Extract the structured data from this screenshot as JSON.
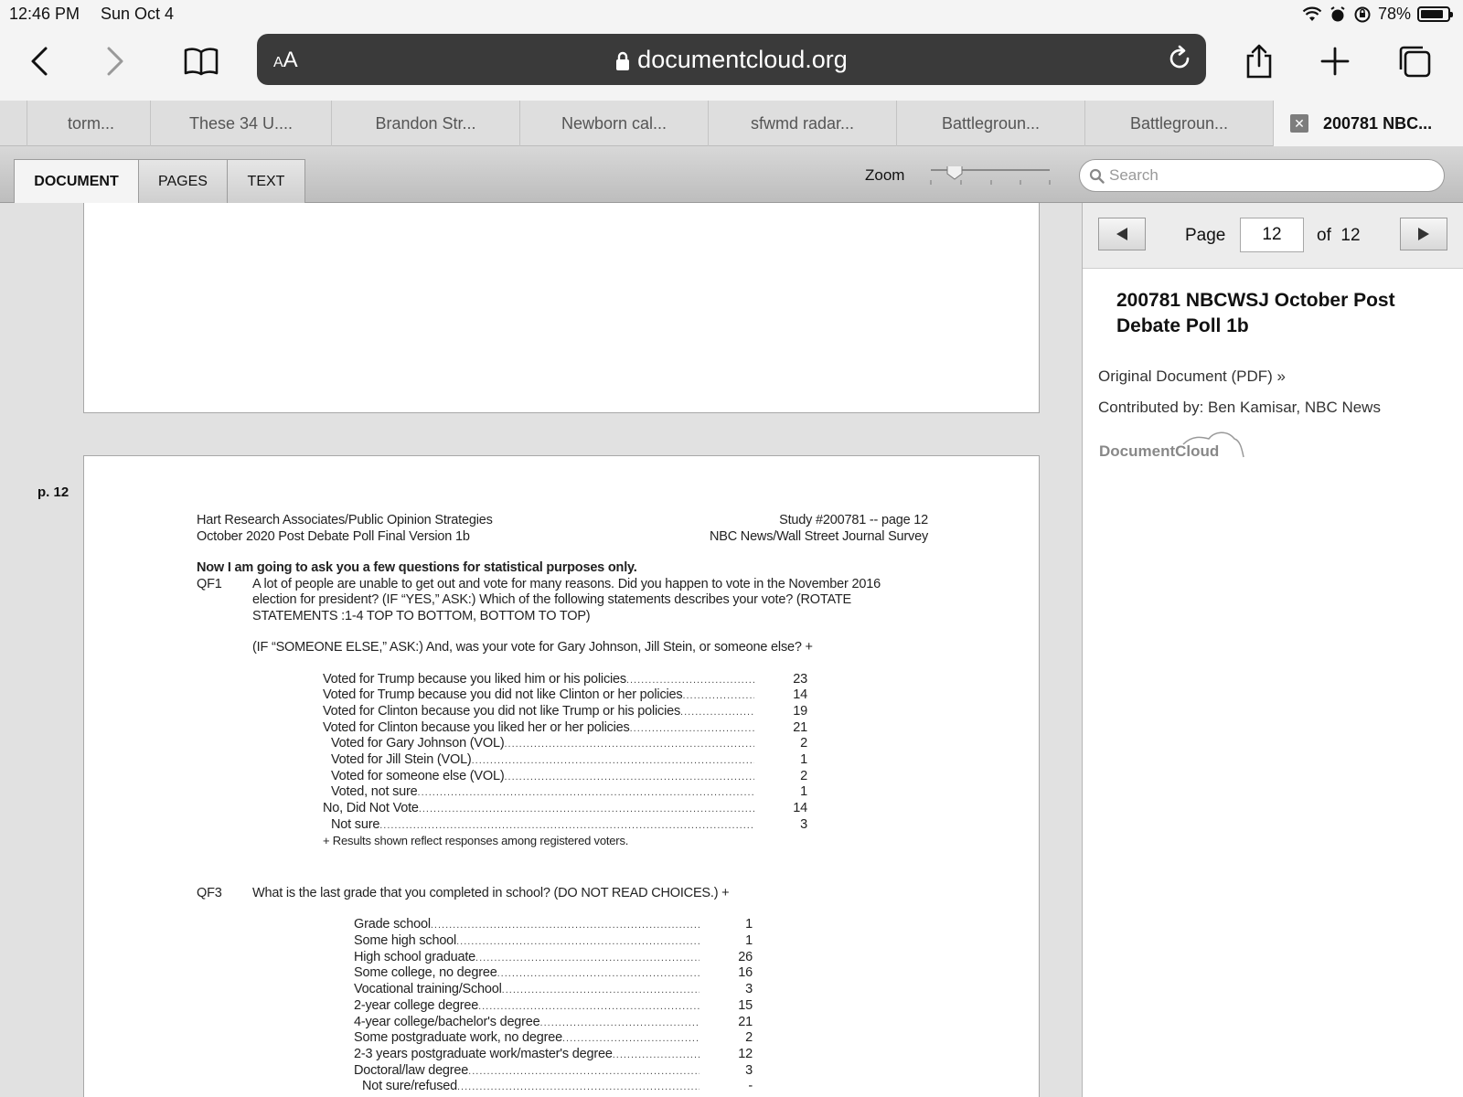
{
  "status": {
    "time": "12:46 PM",
    "date": "Sun Oct 4",
    "battery": "78%"
  },
  "browser": {
    "aa_label_small": "A",
    "aa_label_big": "A",
    "url": "documentcloud.org"
  },
  "tabs": [
    {
      "label": "torm..."
    },
    {
      "label": "These 34 U...."
    },
    {
      "label": "Brandon Str..."
    },
    {
      "label": "Newborn cal..."
    },
    {
      "label": "sfwmd radar..."
    },
    {
      "label": "Battlegroun..."
    },
    {
      "label": "Battlegroun..."
    }
  ],
  "active_tab": {
    "label": "200781 NBC..."
  },
  "viewer": {
    "tabs": {
      "document": "DOCUMENT",
      "pages": "PAGES",
      "text": "TEXT"
    },
    "zoom_label": "Zoom",
    "zoom_level": 0.2,
    "search_placeholder": "Search",
    "page_marker": "p. 12"
  },
  "pager": {
    "label": "Page",
    "current": "12",
    "of_label": "of",
    "total": "12"
  },
  "sidebar": {
    "title": "200781 NBCWSJ October Post Debate Poll 1b",
    "original_link": "Original Document (PDF) »",
    "contributed": "Contributed by: Ben Kamisar, NBC News",
    "logo": "DocumentCloud"
  },
  "document": {
    "header_left_1": "Hart Research Associates/Public Opinion Strategies",
    "header_left_2": "October 2020 Post Debate Poll Final Version 1b",
    "header_right_1": "Study #200781 -- page 12",
    "header_right_2": "NBC News/Wall Street Journal Survey",
    "intro": "Now I am going to ask you a few questions for statistical purposes only.",
    "qf1": {
      "id": "QF1",
      "text": "A lot of people are unable to get out and vote for many reasons. Did you happen to vote in the November 2016 election for president? (IF “YES,” ASK:) Which of the following statements describes your vote? (ROTATE STATEMENTS :1-4 TOP TO BOTTOM, BOTTOM TO TOP)",
      "sub": "(IF “SOMEONE ELSE,” ASK:) And, was your vote for Gary Johnson, Jill Stein, or someone else? +",
      "rows": [
        {
          "label": "Voted for Trump because you liked him or his policies",
          "value": "23",
          "indent": false
        },
        {
          "label": "Voted for Trump because you did not like Clinton or her policies",
          "value": "14",
          "indent": false
        },
        {
          "label": "Voted for Clinton because you did not like Trump or his policies",
          "value": "19",
          "indent": false
        },
        {
          "label": "Voted for Clinton because you liked her or her policies",
          "value": "21",
          "indent": false
        },
        {
          "label": "Voted for Gary Johnson (VOL)",
          "value": "2",
          "indent": true
        },
        {
          "label": "Voted for Jill Stein (VOL)",
          "value": "1",
          "indent": true
        },
        {
          "label": "Voted for someone else (VOL)",
          "value": "2",
          "indent": true
        },
        {
          "label": "Voted, not sure",
          "value": "1",
          "indent": true
        },
        {
          "label": "No, Did Not Vote",
          "value": "14",
          "indent": false
        },
        {
          "label": "Not sure",
          "value": "3",
          "indent": true
        }
      ],
      "note": "+ Results shown reflect responses among registered voters."
    },
    "qf3": {
      "id": "QF3",
      "text": "What is the last grade that you completed in school? (DO NOT READ CHOICES.) +",
      "rows": [
        {
          "label": "Grade school",
          "value": "1",
          "indent": false
        },
        {
          "label": "Some high school",
          "value": "1",
          "indent": false
        },
        {
          "label": "High school graduate",
          "value": "26",
          "indent": false
        },
        {
          "label": "Some college, no degree",
          "value": "16",
          "indent": false
        },
        {
          "label": "Vocational training/School",
          "value": "3",
          "indent": false
        },
        {
          "label": "2-year college degree",
          "value": "15",
          "indent": false
        },
        {
          "label": "4-year college/bachelor's degree",
          "value": "21",
          "indent": false
        },
        {
          "label": "Some postgraduate work, no degree",
          "value": "2",
          "indent": false
        },
        {
          "label": "2-3 years postgraduate work/master's degree",
          "value": "12",
          "indent": false
        },
        {
          "label": "Doctoral/law degree",
          "value": "3",
          "indent": false
        },
        {
          "label": "Not sure/refused",
          "value": "-",
          "indent": true
        }
      ]
    }
  }
}
